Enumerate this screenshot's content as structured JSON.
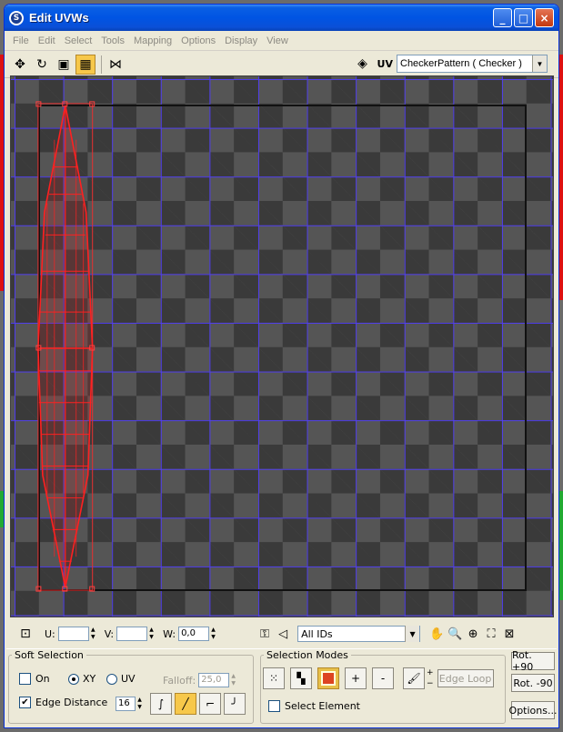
{
  "window": {
    "title": "Edit UVWs"
  },
  "titlebar_buttons": {
    "minimize": "_",
    "maximize": "□",
    "close": "×"
  },
  "menu": [
    "File",
    "Edit",
    "Select",
    "Tools",
    "Mapping",
    "Options",
    "Display",
    "View"
  ],
  "toolbar": {
    "uv_label": "UV",
    "map_select_value": "CheckerPattern  ( Checker )"
  },
  "bottom": {
    "u_label": "U:",
    "u_value": "",
    "v_label": "V:",
    "v_value": "",
    "w_label": "W:",
    "w_value": "0,0",
    "ids_value": "All IDs"
  },
  "soft_selection": {
    "legend": "Soft Selection",
    "on_label": "On",
    "xy_label": "XY",
    "uv_label": "UV",
    "falloff_label": "Falloff:",
    "falloff_value": "25,0",
    "edge_distance_label": "Edge Distance",
    "edge_distance_value": "16"
  },
  "selection_modes": {
    "legend": "Selection Modes",
    "plus_label": "+",
    "minus_label": "-",
    "edge_loop_label": "Edge Loop",
    "select_element_label": "Select Element"
  },
  "rotate": {
    "rot_plus": "Rot. +90",
    "rot_minus": "Rot. -90",
    "options": "Options..."
  },
  "colors": {
    "uv_edge": "#ff2020",
    "grid_line": "#5040ff",
    "checker_light": "#555555",
    "checker_dark": "#3a3a3a",
    "titlebar": "#0054e3"
  }
}
